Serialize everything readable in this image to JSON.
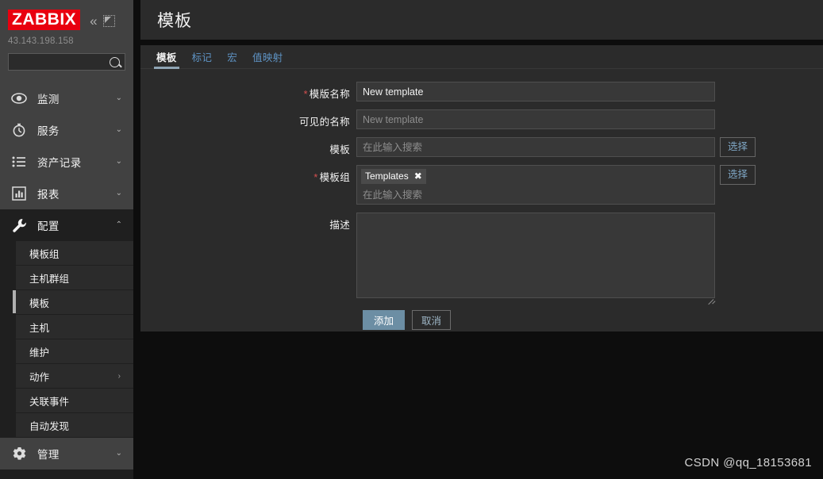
{
  "sidebar": {
    "logo_text": "ZABBIX",
    "server_ip": "43.143.198.158",
    "search_value": "",
    "search_placeholder": "",
    "collapse_icon": "«",
    "nav": [
      {
        "label": "监测",
        "icon": "eye-icon",
        "chevron": "⌄",
        "active": false
      },
      {
        "label": "服务",
        "icon": "stopwatch-icon",
        "chevron": "⌄",
        "active": false
      },
      {
        "label": "资产记录",
        "icon": "list-icon",
        "chevron": "⌄",
        "active": false
      },
      {
        "label": "报表",
        "icon": "chart-icon",
        "chevron": "⌄",
        "active": false
      },
      {
        "label": "配置",
        "icon": "wrench-icon",
        "chevron": "⌃",
        "active": true
      }
    ],
    "submenu": [
      {
        "label": "模板组",
        "active": false,
        "chevron": ""
      },
      {
        "label": "主机群组",
        "active": false,
        "chevron": ""
      },
      {
        "label": "模板",
        "active": true,
        "chevron": ""
      },
      {
        "label": "主机",
        "active": false,
        "chevron": ""
      },
      {
        "label": "维护",
        "active": false,
        "chevron": ""
      },
      {
        "label": "动作",
        "active": false,
        "chevron": "›"
      },
      {
        "label": "关联事件",
        "active": false,
        "chevron": ""
      },
      {
        "label": "自动发现",
        "active": false,
        "chevron": ""
      }
    ],
    "bottom_nav": {
      "label": "管理",
      "icon": "gear-icon",
      "chevron": "⌄"
    }
  },
  "header": {
    "title": "模板"
  },
  "tabs": [
    {
      "label": "模板",
      "active": true
    },
    {
      "label": "标记",
      "active": false
    },
    {
      "label": "宏",
      "active": false
    },
    {
      "label": "值映射",
      "active": false
    }
  ],
  "form": {
    "template_name": {
      "label": "模版名称",
      "required": true,
      "value": "New template",
      "placeholder": ""
    },
    "visible_name": {
      "label": "可见的名称",
      "required": false,
      "value": "",
      "placeholder": "New template"
    },
    "templates": {
      "label": "模板",
      "required": false,
      "value": "",
      "placeholder": "在此输入搜索",
      "select_button": "选择"
    },
    "template_groups": {
      "label": "模板组",
      "required": true,
      "chips": [
        {
          "text": "Templates",
          "remove_icon": "✖"
        }
      ],
      "placeholder": "在此输入搜索",
      "select_button": "选择"
    },
    "description": {
      "label": "描述",
      "required": false,
      "value": "",
      "placeholder": ""
    },
    "submit_button": "添加",
    "cancel_button": "取消"
  },
  "watermark": "CSDN @qq_18153681",
  "colors": {
    "brand_red": "#e8000f",
    "accent_blue": "#5e93c4",
    "primary_button": "#6c8ea4",
    "required_star": "#d64f4f",
    "sidebar_bg": "#414141",
    "panel_bg": "#2b2b2b"
  }
}
